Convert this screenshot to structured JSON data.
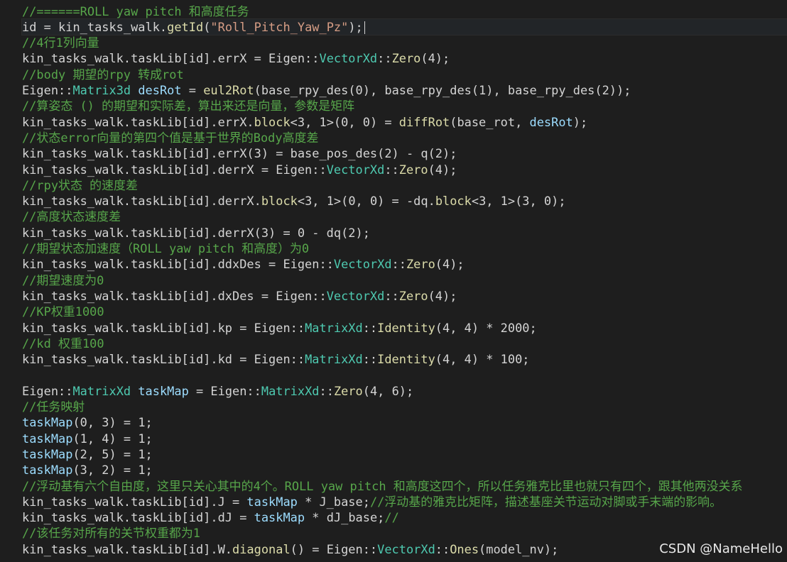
{
  "colors": {
    "background": "#1e1e1e",
    "comment": "#57a64a",
    "type": "#4ec9b0",
    "function": "#dcdcaa",
    "string": "#d69d85",
    "variable": "#9cdcfe",
    "text": "#d4d4d4"
  },
  "code": {
    "lines": [
      {
        "tokens": [
          {
            "t": "//======ROLL yaw pitch 和高度任务",
            "c": "comment"
          }
        ]
      },
      {
        "current": true,
        "tokens": [
          {
            "t": "id = kin_tasks_walk.",
            "c": "plain"
          },
          {
            "t": "getId",
            "c": "fn"
          },
          {
            "t": "(",
            "c": "plain"
          },
          {
            "t": "\"Roll_Pitch_Yaw_Pz\"",
            "c": "str"
          },
          {
            "t": ");",
            "c": "plain"
          }
        ]
      },
      {
        "tokens": [
          {
            "t": "//4行1列向量",
            "c": "comment"
          }
        ]
      },
      {
        "tokens": [
          {
            "t": "kin_tasks_walk.taskLib[id].errX = Eigen::",
            "c": "plain"
          },
          {
            "t": "VectorXd",
            "c": "type"
          },
          {
            "t": "::",
            "c": "plain"
          },
          {
            "t": "Zero",
            "c": "fn"
          },
          {
            "t": "(4);",
            "c": "plain"
          }
        ]
      },
      {
        "tokens": [
          {
            "t": "//body 期望的rpy 转成rot",
            "c": "comment"
          }
        ]
      },
      {
        "tokens": [
          {
            "t": "Eigen::",
            "c": "plain"
          },
          {
            "t": "Matrix3d",
            "c": "type"
          },
          {
            "t": " ",
            "c": "plain"
          },
          {
            "t": "desRot",
            "c": "var"
          },
          {
            "t": " = ",
            "c": "plain"
          },
          {
            "t": "eul2Rot",
            "c": "fn"
          },
          {
            "t": "(base_rpy_des(0), base_rpy_des(1), base_rpy_des(2));",
            "c": "plain"
          }
        ]
      },
      {
        "tokens": [
          {
            "t": "//算姿态 () 的期望和实际差，算出来还是向量，参数是矩阵",
            "c": "comment"
          }
        ]
      },
      {
        "tokens": [
          {
            "t": "kin_tasks_walk.taskLib[id].errX.",
            "c": "plain"
          },
          {
            "t": "block",
            "c": "fn"
          },
          {
            "t": "<3, 1>(0, 0) = ",
            "c": "plain"
          },
          {
            "t": "diffRot",
            "c": "fn"
          },
          {
            "t": "(base_rot, ",
            "c": "plain"
          },
          {
            "t": "desRot",
            "c": "var"
          },
          {
            "t": ");",
            "c": "plain"
          }
        ]
      },
      {
        "tokens": [
          {
            "t": "//状态error向量的第四个值是基于世界的Body高度差",
            "c": "comment"
          }
        ]
      },
      {
        "tokens": [
          {
            "t": "kin_tasks_walk.taskLib[id].errX(3) = base_pos_des(2) - q(2);",
            "c": "plain"
          }
        ]
      },
      {
        "tokens": [
          {
            "t": "kin_tasks_walk.taskLib[id].derrX = Eigen::",
            "c": "plain"
          },
          {
            "t": "VectorXd",
            "c": "type"
          },
          {
            "t": "::",
            "c": "plain"
          },
          {
            "t": "Zero",
            "c": "fn"
          },
          {
            "t": "(4);",
            "c": "plain"
          }
        ]
      },
      {
        "tokens": [
          {
            "t": "//rpy状态 的速度差",
            "c": "comment"
          }
        ]
      },
      {
        "tokens": [
          {
            "t": "kin_tasks_walk.taskLib[id].derrX.",
            "c": "plain"
          },
          {
            "t": "block",
            "c": "fn"
          },
          {
            "t": "<3, 1>(0, 0) = -dq.",
            "c": "plain"
          },
          {
            "t": "block",
            "c": "fn"
          },
          {
            "t": "<3, 1>(3, 0);",
            "c": "plain"
          }
        ]
      },
      {
        "tokens": [
          {
            "t": "//高度状态速度差",
            "c": "comment"
          }
        ]
      },
      {
        "tokens": [
          {
            "t": "kin_tasks_walk.taskLib[id].derrX(3) = 0 - dq(2);",
            "c": "plain"
          }
        ]
      },
      {
        "tokens": [
          {
            "t": "//期望状态加速度（ROLL yaw pitch 和高度）为0",
            "c": "comment"
          }
        ]
      },
      {
        "tokens": [
          {
            "t": "kin_tasks_walk.taskLib[id].ddxDes = Eigen::",
            "c": "plain"
          },
          {
            "t": "VectorXd",
            "c": "type"
          },
          {
            "t": "::",
            "c": "plain"
          },
          {
            "t": "Zero",
            "c": "fn"
          },
          {
            "t": "(4);",
            "c": "plain"
          }
        ]
      },
      {
        "tokens": [
          {
            "t": "//期望速度为0",
            "c": "comment"
          }
        ]
      },
      {
        "tokens": [
          {
            "t": "kin_tasks_walk.taskLib[id].dxDes = Eigen::",
            "c": "plain"
          },
          {
            "t": "VectorXd",
            "c": "type"
          },
          {
            "t": "::",
            "c": "plain"
          },
          {
            "t": "Zero",
            "c": "fn"
          },
          {
            "t": "(4);",
            "c": "plain"
          }
        ]
      },
      {
        "tokens": [
          {
            "t": "//KP权重1000",
            "c": "comment"
          }
        ]
      },
      {
        "tokens": [
          {
            "t": "kin_tasks_walk.taskLib[id].kp = Eigen::",
            "c": "plain"
          },
          {
            "t": "MatrixXd",
            "c": "type"
          },
          {
            "t": "::",
            "c": "plain"
          },
          {
            "t": "Identity",
            "c": "fn"
          },
          {
            "t": "(4, 4) * 2000;",
            "c": "plain"
          }
        ]
      },
      {
        "tokens": [
          {
            "t": "//kd 权重100",
            "c": "comment"
          }
        ]
      },
      {
        "tokens": [
          {
            "t": "kin_tasks_walk.taskLib[id].kd = Eigen::",
            "c": "plain"
          },
          {
            "t": "MatrixXd",
            "c": "type"
          },
          {
            "t": "::",
            "c": "plain"
          },
          {
            "t": "Identity",
            "c": "fn"
          },
          {
            "t": "(4, 4) * 100;",
            "c": "plain"
          }
        ]
      },
      {
        "tokens": []
      },
      {
        "tokens": [
          {
            "t": "Eigen::",
            "c": "plain"
          },
          {
            "t": "MatrixXd",
            "c": "type"
          },
          {
            "t": " ",
            "c": "plain"
          },
          {
            "t": "taskMap",
            "c": "var"
          },
          {
            "t": " = Eigen::",
            "c": "plain"
          },
          {
            "t": "MatrixXd",
            "c": "type"
          },
          {
            "t": "::",
            "c": "plain"
          },
          {
            "t": "Zero",
            "c": "fn"
          },
          {
            "t": "(4, 6);",
            "c": "plain"
          }
        ]
      },
      {
        "tokens": [
          {
            "t": "//任务映射",
            "c": "comment"
          }
        ]
      },
      {
        "tokens": [
          {
            "t": "taskMap",
            "c": "var"
          },
          {
            "t": "(0, 3) = 1;",
            "c": "plain"
          }
        ]
      },
      {
        "tokens": [
          {
            "t": "taskMap",
            "c": "var"
          },
          {
            "t": "(1, 4) = 1;",
            "c": "plain"
          }
        ]
      },
      {
        "tokens": [
          {
            "t": "taskMap",
            "c": "var"
          },
          {
            "t": "(2, 5) = 1;",
            "c": "plain"
          }
        ]
      },
      {
        "tokens": [
          {
            "t": "taskMap",
            "c": "var"
          },
          {
            "t": "(3, 2) = 1;",
            "c": "plain"
          }
        ]
      },
      {
        "tokens": [
          {
            "t": "//浮动基有六个自由度，这里只关心其中的4个。ROLL yaw pitch 和高度这四个，所以任务雅克比里也就只有四个，跟其他两没关系",
            "c": "comment"
          }
        ]
      },
      {
        "tokens": [
          {
            "t": "kin_tasks_walk.taskLib[id].J = ",
            "c": "plain"
          },
          {
            "t": "taskMap",
            "c": "var"
          },
          {
            "t": " * J_base;",
            "c": "plain"
          },
          {
            "t": "//浮动基的雅克比矩阵，描述基座关节运动对脚或手末端的影响。",
            "c": "comment"
          }
        ]
      },
      {
        "tokens": [
          {
            "t": "kin_tasks_walk.taskLib[id].dJ = ",
            "c": "plain"
          },
          {
            "t": "taskMap",
            "c": "var"
          },
          {
            "t": " * dJ_base;",
            "c": "plain"
          },
          {
            "t": "//",
            "c": "comment"
          }
        ]
      },
      {
        "tokens": [
          {
            "t": "//该任务对所有的关节权重都为1",
            "c": "comment"
          }
        ]
      },
      {
        "tokens": [
          {
            "t": "kin_tasks_walk.taskLib[id].W.",
            "c": "plain"
          },
          {
            "t": "diagonal",
            "c": "fn"
          },
          {
            "t": "() = Eigen::",
            "c": "plain"
          },
          {
            "t": "VectorXd",
            "c": "type"
          },
          {
            "t": "::",
            "c": "plain"
          },
          {
            "t": "Ones",
            "c": "fn"
          },
          {
            "t": "(model_nv);",
            "c": "plain"
          }
        ]
      }
    ]
  },
  "watermark": "CSDN @NameHello"
}
